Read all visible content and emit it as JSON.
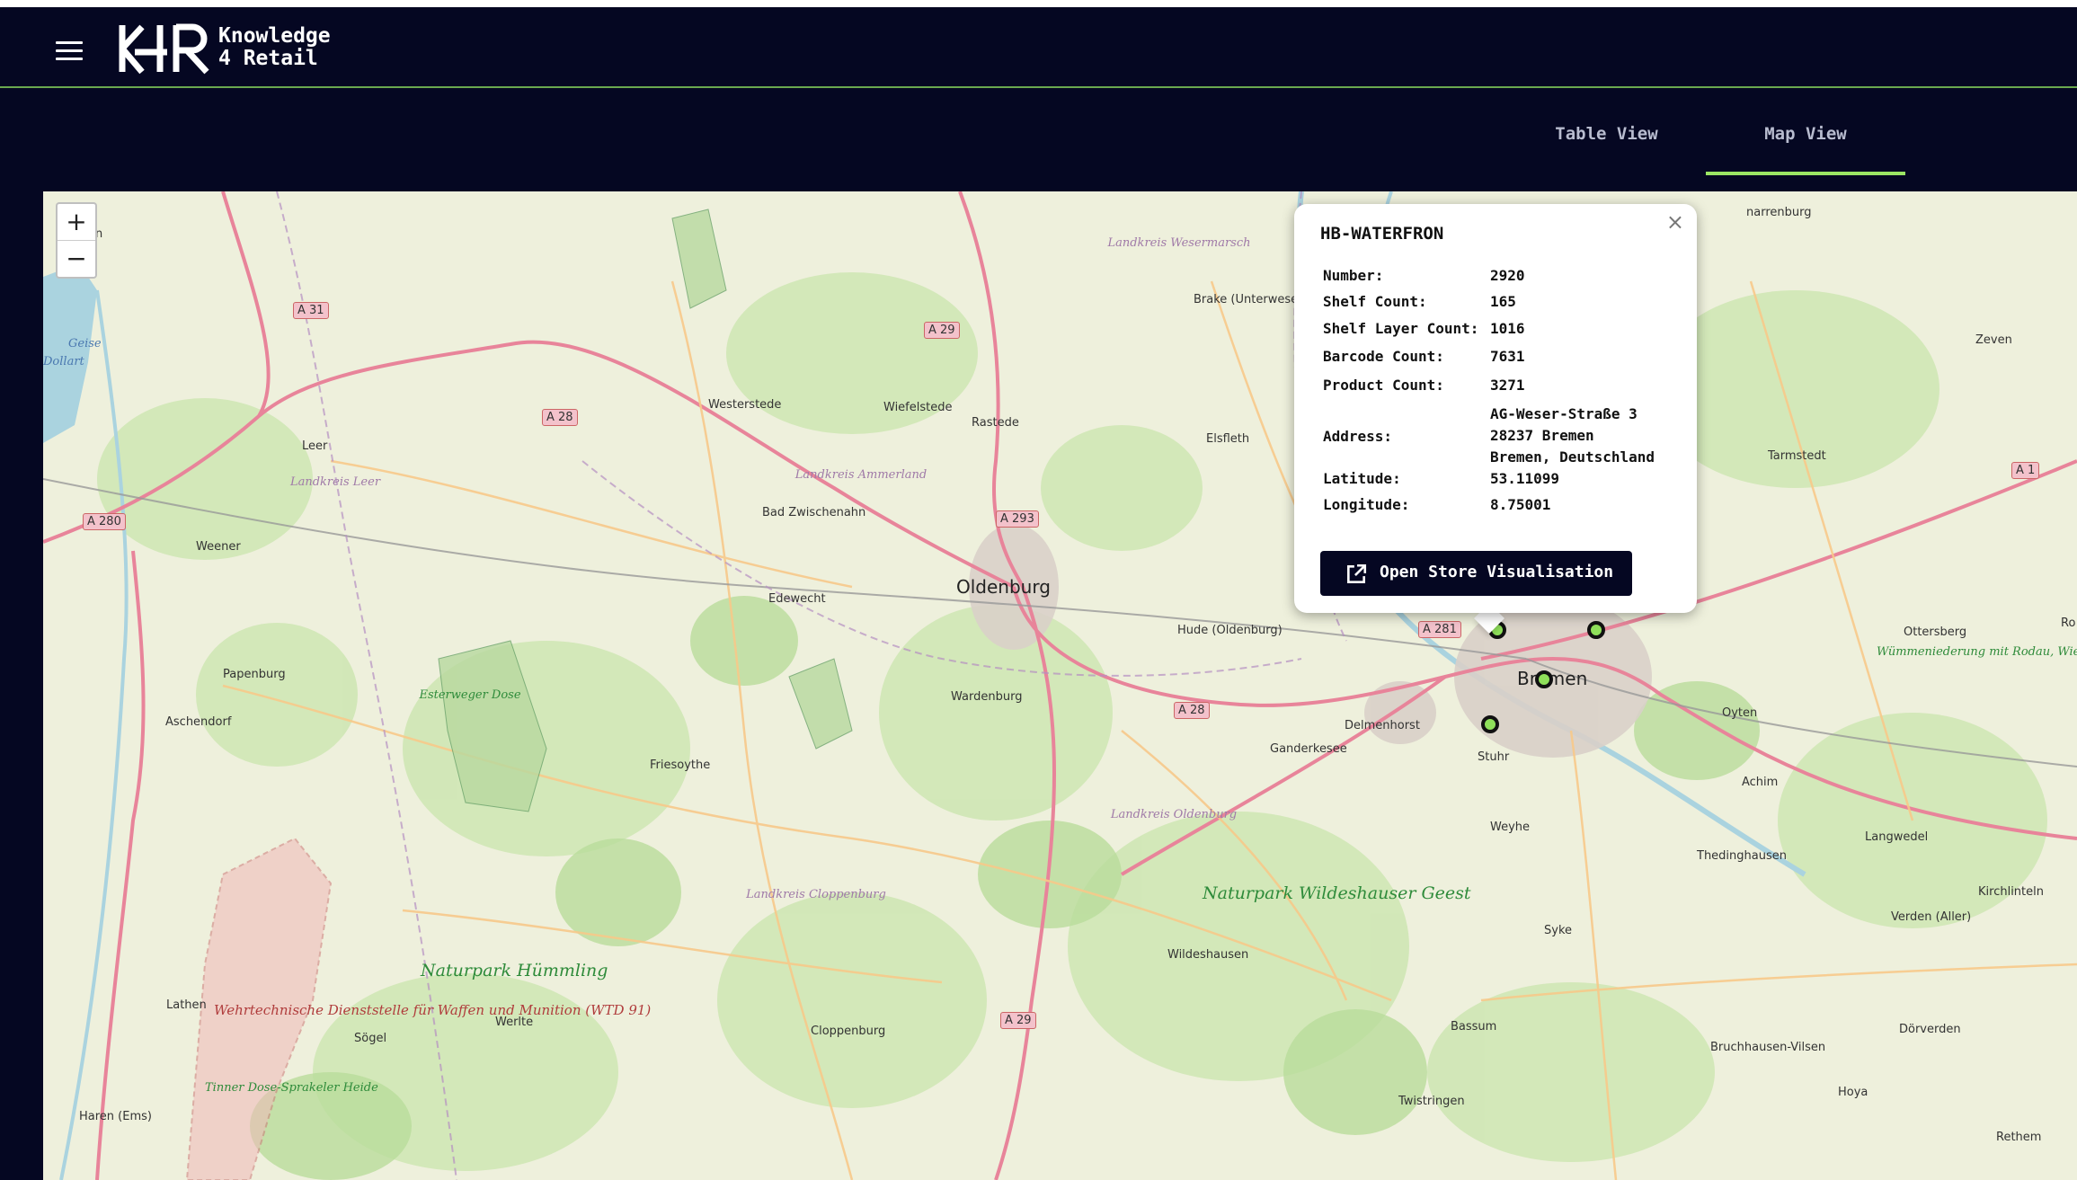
{
  "header": {
    "brand_line1": "Knowledge",
    "brand_line2": "4 Retail",
    "menu_icon": "hamburger-menu-icon",
    "logo_icon": "k4r-logo"
  },
  "tabs": [
    {
      "label": "Table View",
      "active": false
    },
    {
      "label": "Map View",
      "active": true
    }
  ],
  "colors": {
    "background": "#050722",
    "accent": "#9be564",
    "header_border": "#6aa84f",
    "marker_fill": "#8fe05a"
  },
  "zoom": {
    "in": "+",
    "out": "−"
  },
  "popup": {
    "title": "HB-WATERFRON",
    "close": "×",
    "rows": [
      {
        "label": "Number:",
        "value": "2920"
      },
      {
        "label": "Shelf Count:",
        "value": "165"
      },
      {
        "label": "Shelf Layer Count:",
        "value": "1016"
      },
      {
        "label": "Barcode Count:",
        "value": "7631"
      },
      {
        "label": "Product Count:",
        "value": "3271"
      },
      {
        "label": "Address:",
        "value_lines": [
          "AG-Weser-Straße 3",
          "28237 Bremen",
          "Bremen, Deutschland"
        ]
      },
      {
        "label": "Latitude:",
        "value": "53.11099"
      },
      {
        "label": "Longitude:",
        "value": "8.75001"
      }
    ],
    "button_label": "Open Store Visualisation",
    "button_icon": "open-external-icon"
  },
  "map": {
    "cities": [
      "Oldenburg",
      "Bremen"
    ],
    "towns": [
      "Westerstede",
      "Wiefelstede",
      "Rastede",
      "Brake (Unterweser)",
      "Elsfleth",
      "Leer",
      "Weener",
      "Bad Zwischenahn",
      "Edewecht",
      "Hude (Oldenburg)",
      "Papenburg",
      "Aschendorf",
      "Wardenburg",
      "Delmenhorst",
      "Ganderkesee",
      "Stuhr",
      "Friesoythe",
      "Weyhe",
      "Achim",
      "Oyten",
      "Ottersberg",
      "Thedinghausen",
      "Langwedel",
      "Syke",
      "Wildeshausen",
      "Lathen",
      "Sögel",
      "Werlte",
      "Cloppenburg",
      "Bassum",
      "Verden (Aller)",
      "Kirchlinteln",
      "Dörverden",
      "Bruchhausen-Vilsen",
      "Hoya",
      "Twistringen",
      "Haren (Ems)",
      "Zeven",
      "Tarmstedt",
      "Rethem",
      "Ro",
      "narrenburg",
      "en"
    ],
    "districts": [
      "Landkreis Wesermarsch",
      "Landkreis Ammerland",
      "Landkreis Leer",
      "Landkreis Oldenburg",
      "Landkreis Cloppenburg"
    ],
    "parks": [
      "Naturpark Wildeshauser Geest",
      "Naturpark Hümmling"
    ],
    "reserves": [
      "Esterweger Dose",
      "Tinner Dose-Sprakeler Heide",
      "Wümmeniederung mit Rodau, Wiedau und Trochelbach"
    ],
    "military": "Wehrtechnische Dienststelle für Waffen und Munition (WTD 91)",
    "water": [
      "Geise",
      "Dollart"
    ],
    "roads": [
      "A 31",
      "A 28",
      "A 29",
      "A 293",
      "A 280",
      "A 281",
      "A 28",
      "A 29",
      "A 1"
    ],
    "markers": 4
  }
}
